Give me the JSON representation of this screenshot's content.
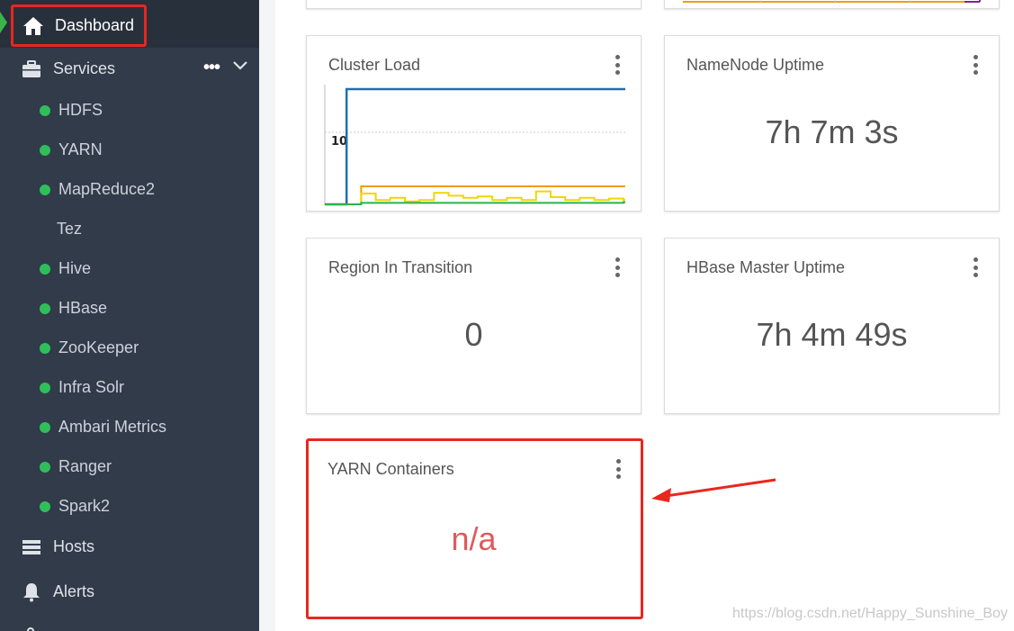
{
  "sidebar": {
    "dashboard_label": "Dashboard",
    "services_label": "Services",
    "services_more": "•••",
    "services": [
      {
        "label": "HDFS",
        "has_status": true
      },
      {
        "label": "YARN",
        "has_status": true
      },
      {
        "label": "MapReduce2",
        "has_status": true
      },
      {
        "label": "Tez",
        "has_status": false
      },
      {
        "label": "Hive",
        "has_status": true
      },
      {
        "label": "HBase",
        "has_status": true
      },
      {
        "label": "ZooKeeper",
        "has_status": true
      },
      {
        "label": "Infra Solr",
        "has_status": true
      },
      {
        "label": "Ambari Metrics",
        "has_status": true
      },
      {
        "label": "Ranger",
        "has_status": true
      },
      {
        "label": "Spark2",
        "has_status": true
      }
    ],
    "hosts_label": "Hosts",
    "alerts_label": "Alerts",
    "status_color": "#2fbf5a",
    "active_marker_color": "#3bb54a"
  },
  "widgets": {
    "cluster_load": {
      "title": "Cluster Load",
      "y_tick": "10"
    },
    "namenode_uptime": {
      "title": "NameNode Uptime",
      "value": "7h 7m 3s"
    },
    "region_transition": {
      "title": "Region In Transition",
      "value": "0"
    },
    "hbase_master_uptime": {
      "title": "HBase Master Uptime",
      "value": "7h 4m 49s"
    },
    "yarn_containers": {
      "title": "YARN Containers",
      "value": "n/a"
    }
  },
  "chart_data": {
    "type": "line",
    "title": "Cluster Load",
    "y_ticks": [
      "10"
    ],
    "ylim": [
      0,
      16
    ],
    "x": [
      0,
      1,
      2,
      3,
      4,
      5,
      6,
      7,
      8,
      9,
      10,
      11,
      12,
      13,
      14,
      15,
      16,
      17,
      18,
      19,
      20
    ],
    "series": [
      {
        "color": "#1f6fb2",
        "values": [
          0,
          16,
          16,
          16,
          16,
          16,
          16,
          16,
          16,
          16,
          16,
          16,
          16,
          16,
          16,
          16,
          16,
          16,
          16,
          16,
          16
        ]
      },
      {
        "color": "#f39c12",
        "values": [
          0,
          0,
          2.5,
          2.5,
          2.5,
          2.5,
          2.5,
          2.5,
          2.5,
          2.5,
          2.5,
          2.5,
          2.5,
          2.5,
          2.5,
          2.5,
          2.5,
          2.5,
          2.5,
          2.5,
          2.5
        ]
      },
      {
        "color": "#f1d600",
        "values": [
          0,
          0,
          1.5,
          0.6,
          0.9,
          0.4,
          0.6,
          1.6,
          1.2,
          0.9,
          1.1,
          0.6,
          0.9,
          0.6,
          1.8,
          1.0,
          0.6,
          0.9,
          0.6,
          0.8,
          0.6
        ]
      },
      {
        "color": "#2bb24c",
        "values": [
          0,
          0,
          0.2,
          0.2,
          0.2,
          0.2,
          0.2,
          0.2,
          0.2,
          0.2,
          0.2,
          0.2,
          0.2,
          0.2,
          0.2,
          0.2,
          0.2,
          0.2,
          0.2,
          0.2,
          0.3
        ]
      }
    ],
    "grid": true
  },
  "watermark": "https://blog.csdn.net/Happy_Sunshine_Boy",
  "colors": {
    "highlight": "#e8271f",
    "na_value": "#e05a5a",
    "sidebar_bg": "#313b4a"
  }
}
